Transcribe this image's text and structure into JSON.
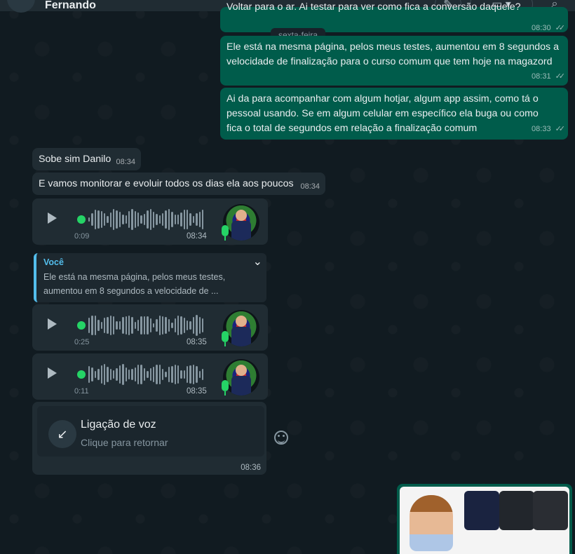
{
  "header": {
    "contact_name": "Fernando"
  },
  "date_chip": "sexta-feira",
  "outgoing": [
    {
      "text": "Voltar para o ar. Ai testar para ver como fica a conversão daquele?",
      "time": "08:30"
    },
    {
      "text": "Ele está na mesma página, pelos meus testes, aumentou em 8 segundos a velocidade de finalização para o curso comum que tem hoje na magazord",
      "time": "08:31"
    },
    {
      "text": "Ai da para acompanhar com algum hotjar, algum app assim, como tá o pessoal usando. Se em algum celular em específico ela buga ou como fica o total de segundos em relação a finalização comum",
      "time": "08:33"
    }
  ],
  "incoming": [
    {
      "text": "Sobe sim Danilo",
      "time": "08:34"
    },
    {
      "text": "E vamos monitorar e evoluir todos os dias ela aos poucos",
      "time": "08:34"
    }
  ],
  "audios": [
    {
      "duration": "0:09",
      "time": "08:34"
    },
    {
      "duration": "0:25",
      "time": "08:35"
    },
    {
      "duration": "0:11",
      "time": "08:35"
    }
  ],
  "quote": {
    "author": "Você",
    "text": "Ele está na mesma página, pelos meus testes, aumentou em 8 segundos a velocidade de ..."
  },
  "call": {
    "title": "Ligação de voz",
    "subtitle": "Clique para retornar",
    "time": "08:36"
  },
  "colors": {
    "outgoing_bubble": "#005c4b",
    "incoming_bubble": "#202c33",
    "accent": "#25d366",
    "quote_accent": "#53bdeb"
  }
}
